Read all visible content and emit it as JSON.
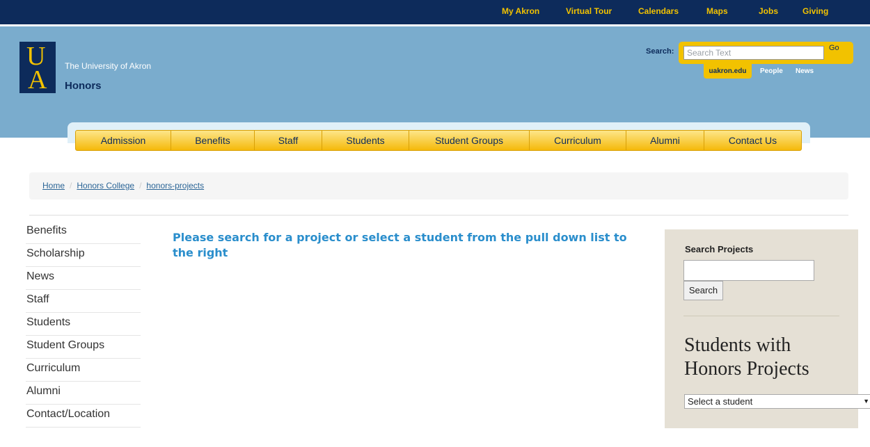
{
  "topnav": {
    "links": [
      "My Akron",
      "Virtual Tour",
      "Calendars",
      "Maps",
      "Jobs",
      "Giving"
    ]
  },
  "header": {
    "logo_letters": [
      "U",
      "A"
    ],
    "university": "The University of Akron",
    "site_title": "Honors",
    "search_label": "Search:",
    "search_placeholder": "Search Text",
    "go_label": "Go",
    "scopes": [
      "uakron.edu",
      "People",
      "News"
    ]
  },
  "mainnav": {
    "items": [
      "Admission",
      "Benefits",
      "Staff",
      "Students",
      "Student Groups",
      "Curriculum",
      "Alumni",
      "Contact Us"
    ]
  },
  "breadcrumb": [
    "Home",
    "Honors College",
    "honors-projects"
  ],
  "sidenav": {
    "items": [
      "Benefits",
      "Scholarship",
      "News",
      "Staff",
      "Students",
      "Student Groups",
      "Curriculum",
      "Alumni",
      "Contact/Location"
    ]
  },
  "main": {
    "heading": "Please search for a project or select a student from the pull down list to the right"
  },
  "sidebar": {
    "search_title": "Search Projects",
    "search_input_value": "",
    "search_button": "Search",
    "students_heading": "Students with Honors Projects",
    "select_value": "Select a student"
  },
  "colors": {
    "navy": "#0d2b5b",
    "gold": "#f2c200",
    "header_blue": "#7aaccd",
    "link_blue": "#2a8ecc",
    "sidebar_bg": "#e5e0d5"
  }
}
